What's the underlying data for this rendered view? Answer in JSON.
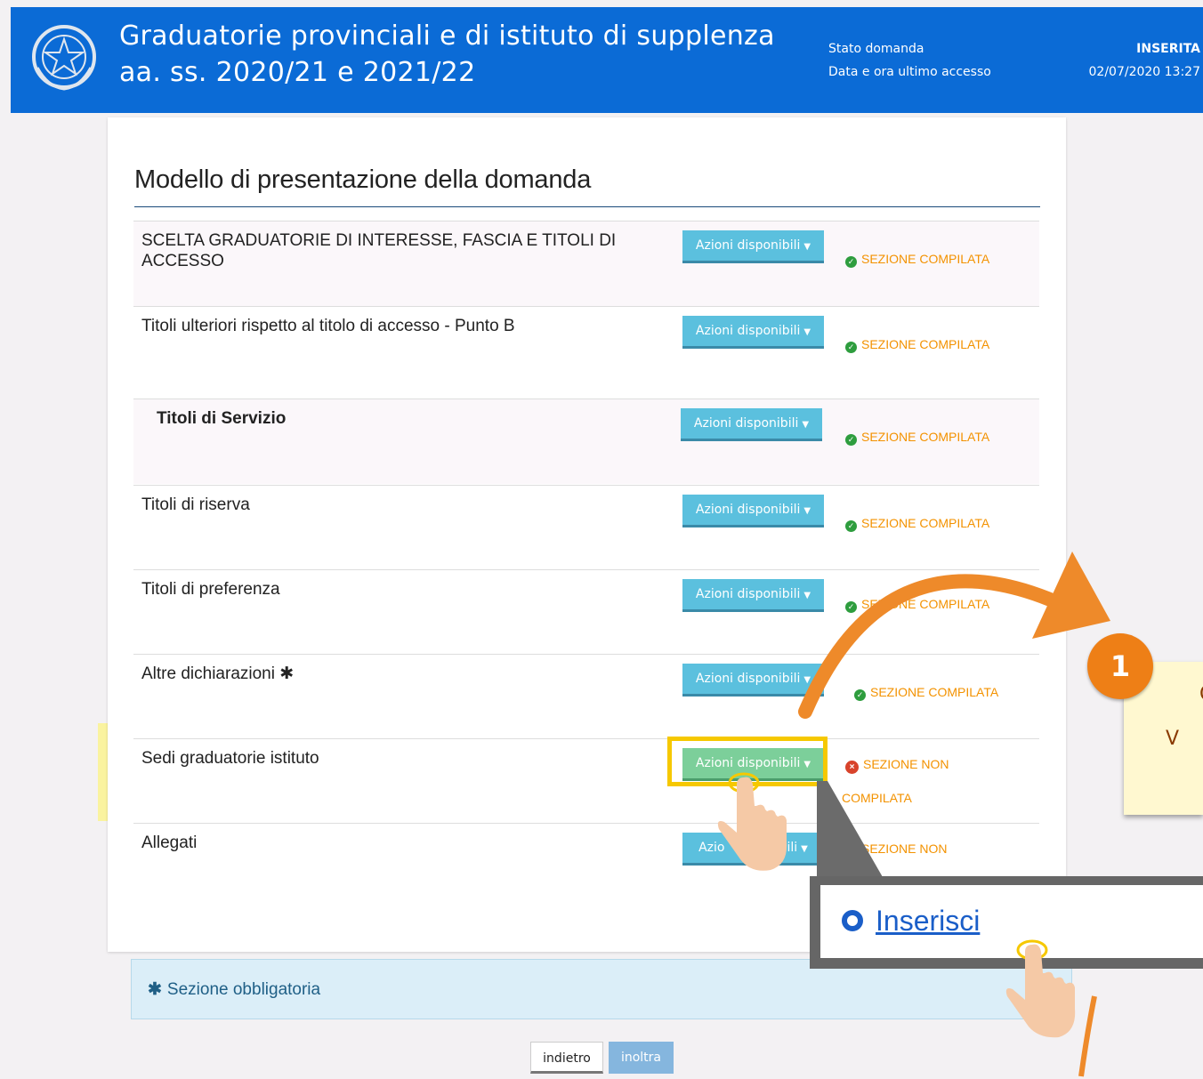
{
  "header": {
    "title_line1": "Graduatorie provinciali e di istituto di supplenza",
    "title_line2": "aa. ss. 2020/21 e 2021/22",
    "status_label": "Stato domanda",
    "status_value": "INSERITA",
    "last_access_label": "Data e ora ultimo accesso",
    "last_access_value": "02/07/2020 13:27"
  },
  "card": {
    "title": "Modello di presentazione della domanda",
    "button_label": "Azioni disponibili",
    "rows": [
      {
        "label": "SCELTA GRADUATORIE DI INTERESSE, FASCIA E TITOLI DI ACCESSO",
        "status": "SEZIONE COMPILATA"
      },
      {
        "label": "Titoli ulteriori rispetto al titolo di accesso - Punto B",
        "status": "SEZIONE COMPILATA"
      },
      {
        "label": "Titoli di Servizio",
        "status": "SEZIONE COMPILATA"
      },
      {
        "label": "Titoli di riserva",
        "status": "SEZIONE COMPILATA"
      },
      {
        "label": "Titoli di preferenza",
        "status": "SEZIONE COMPILATA"
      },
      {
        "label": "Altre dichiarazioni",
        "status": "SEZIONE COMPILATA"
      },
      {
        "label": "Sedi graduatorie istituto",
        "status": "SEZIONE NON",
        "status_line2": "COMPILATA"
      },
      {
        "label": "Allegati",
        "status": "SEZIONE NON",
        "button_partial_left": "Azio",
        "button_partial_right": "ili"
      }
    ]
  },
  "note": {
    "text": "Sezione obbligatoria"
  },
  "footer": {
    "back_label": "indietro",
    "send_label": "inoltra"
  },
  "callout": {
    "step_number": "1",
    "popup_link": "Inserisci",
    "tip_char_1": "C",
    "tip_char_2": "V"
  },
  "colors": {
    "header_bg": "#0b6bd6",
    "button_blue": "#5bc0de",
    "button_green": "#7ccf9a",
    "status_orange": "#f39200",
    "highlight_yellow": "#fff45a",
    "step_orange": "#ee7f16"
  }
}
